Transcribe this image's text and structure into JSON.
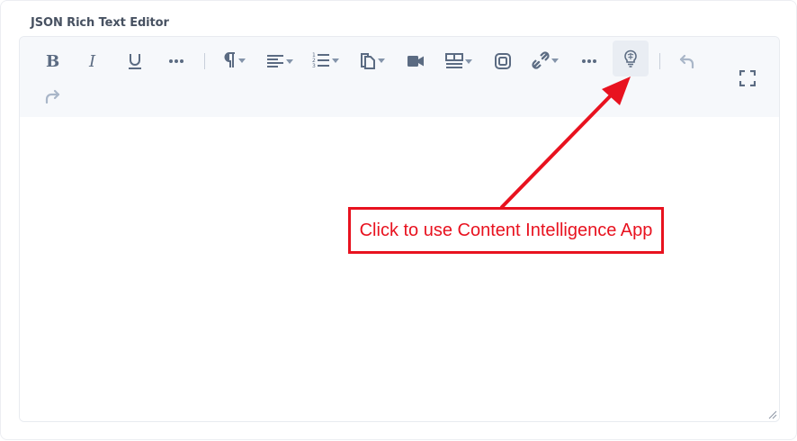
{
  "field": {
    "label": "JSON Rich Text Editor"
  },
  "toolbar": {
    "items": [
      {
        "name": "bold",
        "icon": "bold-icon"
      },
      {
        "name": "italic",
        "icon": "italic-icon"
      },
      {
        "name": "underline",
        "icon": "underline-icon"
      },
      {
        "name": "more-formatting",
        "icon": "ellipsis-icon"
      },
      {
        "name": "paragraph",
        "icon": "pilcrow-icon"
      },
      {
        "name": "alignment",
        "icon": "align-left-icon"
      },
      {
        "name": "ordered-list",
        "icon": "ordered-list-icon"
      },
      {
        "name": "embed",
        "icon": "document-icon"
      },
      {
        "name": "video",
        "icon": "video-icon"
      },
      {
        "name": "table",
        "icon": "table-icon"
      },
      {
        "name": "reference",
        "icon": "square-icon"
      },
      {
        "name": "link",
        "icon": "link-icon"
      },
      {
        "name": "more-options",
        "icon": "ellipsis-icon"
      },
      {
        "name": "content-intelligence",
        "icon": "brain-bulb-icon"
      },
      {
        "name": "undo",
        "icon": "undo-icon"
      },
      {
        "name": "redo",
        "icon": "redo-icon"
      },
      {
        "name": "fullscreen",
        "icon": "fullscreen-icon"
      }
    ]
  },
  "callout": {
    "text": "Click to use Content Intelligence App"
  },
  "colors": {
    "accent": "#e8121f",
    "toolbar_bg": "#f6f8fb",
    "icon": "#5b6b82",
    "icon_muted": "#a9b6c8"
  }
}
